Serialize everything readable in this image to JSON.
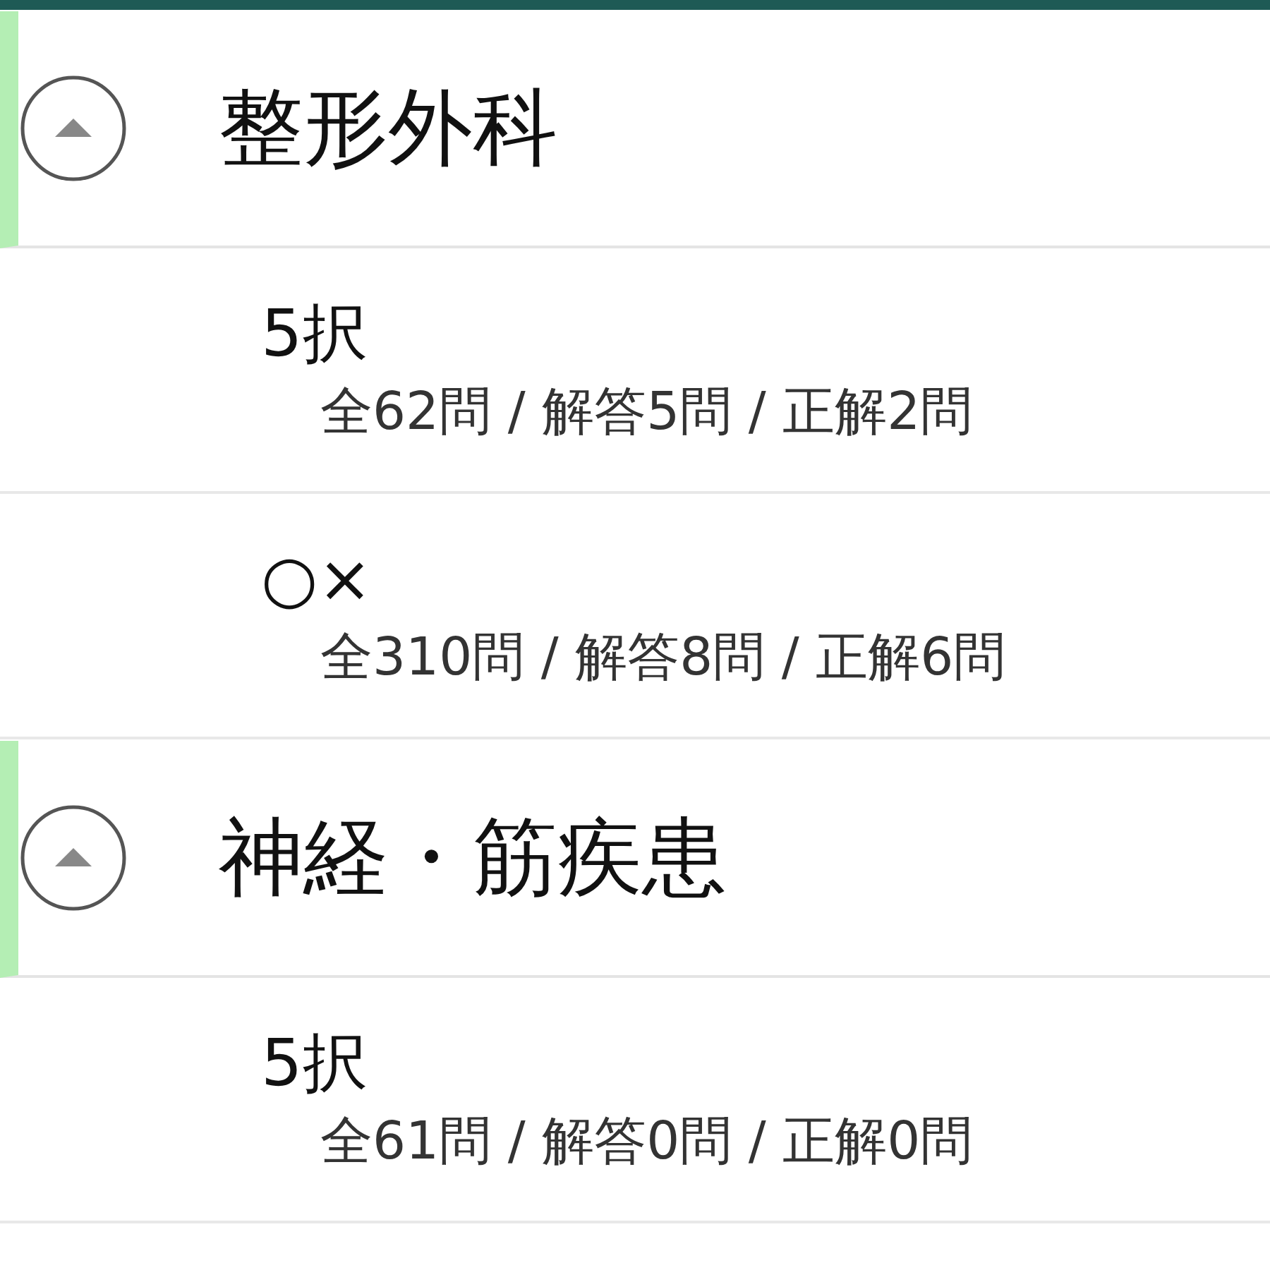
{
  "sections": [
    {
      "title": "整形外科",
      "expanded": true,
      "items": [
        {
          "title": "5択",
          "stats": "全62問 / 解答5問 / 正解2問"
        },
        {
          "title": "○×",
          "stats": "全310問 / 解答8問 / 正解6問"
        }
      ]
    },
    {
      "title": "神経・筋疾患",
      "expanded": true,
      "items": [
        {
          "title": "5択",
          "stats": "全61問 / 解答0問 / 正解0問"
        }
      ]
    }
  ]
}
